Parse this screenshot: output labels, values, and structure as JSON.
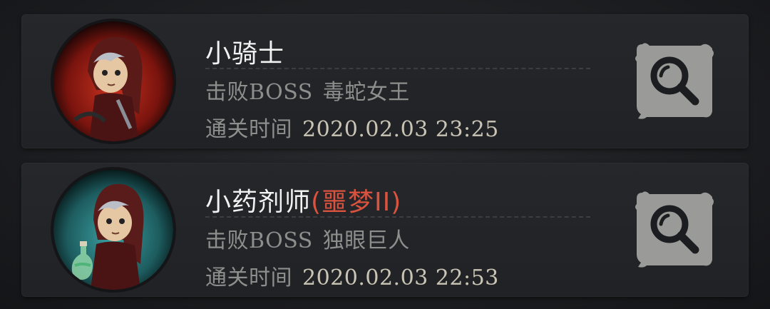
{
  "records": [
    {
      "character_name": "小骑士",
      "name_tag": "",
      "boss_label": "击败BOSS",
      "boss_name": "毒蛇女王",
      "time_label": "通关时间",
      "clear_time": "2020.02.03 23:25",
      "avatar_bg": "#b3261e",
      "search_icon": "magnifier-icon"
    },
    {
      "character_name": "小药剂师",
      "name_tag": "(噩梦II)",
      "boss_label": "击败BOSS",
      "boss_name": "独眼巨人",
      "time_label": "通关时间",
      "clear_time": "2020.02.03 22:53",
      "avatar_bg": "#2e8a8e",
      "search_icon": "magnifier-icon"
    }
  ],
  "colors": {
    "name": "#f2f2f2",
    "tag": "#d9533f",
    "label": "#8e8e8c",
    "time": "#c9c4b4"
  }
}
